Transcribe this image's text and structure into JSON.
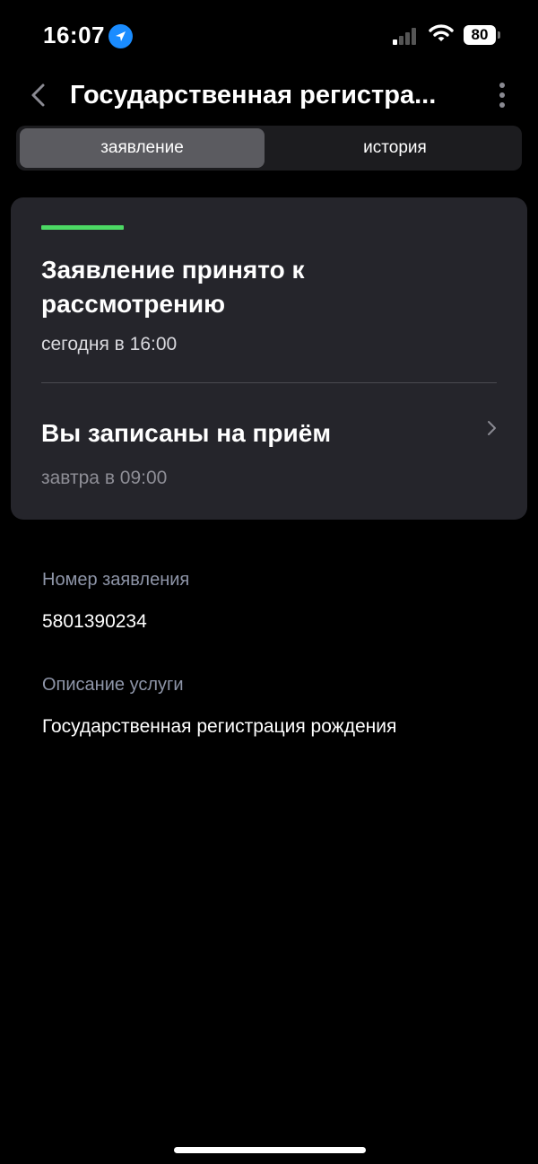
{
  "status_bar": {
    "time": "16:07",
    "battery": "80"
  },
  "header": {
    "title": "Государственная регистра..."
  },
  "tabs": [
    {
      "label": "заявление",
      "active": true
    },
    {
      "label": "история",
      "active": false
    }
  ],
  "status_card": {
    "progress_color": "#4cd964",
    "title": "Заявление принято к рассмотрению",
    "time": "сегодня в 16:00",
    "appointment": {
      "title": "Вы записаны на приём",
      "time": "завтра в 09:00"
    }
  },
  "details": {
    "number_label": "Номер заявления",
    "number_value": "5801390234",
    "description_label": "Описание услуги",
    "description_value": "Государственная регистрация рождения"
  },
  "icons": {
    "location": "location-arrow-icon",
    "signal": "cellular-signal-icon",
    "wifi": "wifi-icon",
    "battery": "battery-icon",
    "back": "chevron-left-icon",
    "more": "more-vertical-icon",
    "chevron": "chevron-right-icon"
  }
}
